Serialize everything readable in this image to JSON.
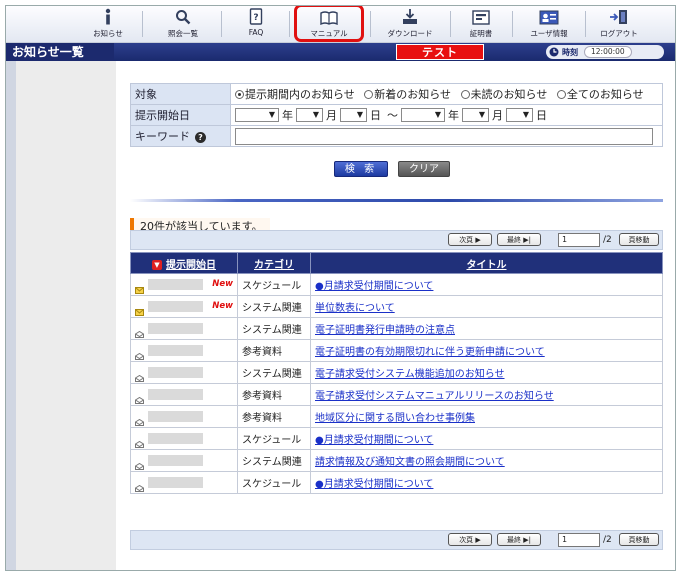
{
  "nav": {
    "items": [
      {
        "label": "お知らせ",
        "icon": "info-icon"
      },
      {
        "label": "照会一覧",
        "icon": "search-icon"
      },
      {
        "label": "FAQ",
        "icon": "faq-icon"
      },
      {
        "label": "マニュアル",
        "icon": "book-icon"
      },
      {
        "label": "ダウンロード",
        "icon": "download-icon"
      },
      {
        "label": "証明書",
        "icon": "certificate-icon"
      },
      {
        "label": "ユーザ情報",
        "icon": "user-card-icon"
      },
      {
        "label": "ログアウト",
        "icon": "logout-icon"
      }
    ],
    "highlighted": "マニュアル"
  },
  "header": {
    "page_title": "お知らせ一覧",
    "env_badge": "テスト",
    "clock_label": "時刻",
    "clock_time": "12:00:00"
  },
  "form": {
    "target_label": "対象",
    "target_options": [
      "提示期間内のお知らせ",
      "新着のお知らせ",
      "未読のお知らせ",
      "全てのお知らせ"
    ],
    "target_selected": "提示期間内のお知らせ",
    "start_date_label": "提示開始日",
    "year_unit": "年",
    "month_unit": "月",
    "day_unit": "日",
    "range_sep": "～",
    "keyword_label": "キーワード",
    "keyword_value": "",
    "search_button": "検 索",
    "clear_button": "クリア"
  },
  "result_count": "20件が該当しています。",
  "pager": {
    "next_label": "次頁 ▶",
    "last_label": "最終 ▶|",
    "page_value": "1",
    "total_label": "/2",
    "go_label": "頁移動"
  },
  "table": {
    "headers": [
      "提示開始日",
      "カテゴリ",
      "タイトル"
    ],
    "sort_mark": "▼",
    "new_label": "New",
    "rows": [
      {
        "read": false,
        "is_new": true,
        "category": "スケジュール",
        "title": "●月請求受付期間について"
      },
      {
        "read": false,
        "is_new": true,
        "category": "システム関連",
        "title": "単位数表について"
      },
      {
        "read": true,
        "is_new": false,
        "category": "システム関連",
        "title": "電子証明書発行申請時の注意点"
      },
      {
        "read": true,
        "is_new": false,
        "category": "参考資料",
        "title": "電子証明書の有効期限切れに伴う更新申請について"
      },
      {
        "read": true,
        "is_new": false,
        "category": "システム関連",
        "title": "電子請求受付システム機能追加のお知らせ"
      },
      {
        "read": true,
        "is_new": false,
        "category": "参考資料",
        "title": "電子請求受付システムマニュアルリリースのお知らせ"
      },
      {
        "read": true,
        "is_new": false,
        "category": "参考資料",
        "title": "地域区分に関する問い合わせ事例集"
      },
      {
        "read": true,
        "is_new": false,
        "category": "スケジュール",
        "title": "●月請求受付期間について"
      },
      {
        "read": true,
        "is_new": false,
        "category": "システム関連",
        "title": "請求情報及び通知文書の照会期間について"
      },
      {
        "read": true,
        "is_new": false,
        "category": "スケジュール",
        "title": "●月請求受付期間について"
      }
    ]
  },
  "colors": {
    "nav_bar": "#e3e8f2",
    "title_bar": "#1a2a6e",
    "highlight": "#e01010",
    "link": "#1a30c8",
    "env_badge": "#e81010"
  }
}
